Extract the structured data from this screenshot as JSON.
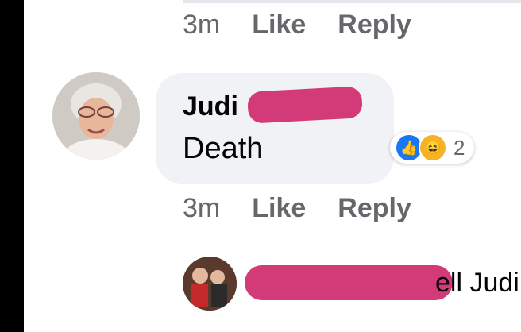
{
  "comment_above": {
    "time": "3m",
    "like_label": "Like",
    "reply_label": "Reply"
  },
  "comment": {
    "author": "Judi",
    "text": "Death",
    "time": "3m",
    "like_label": "Like",
    "reply_label": "Reply",
    "reactions": {
      "icons": [
        "like-reaction",
        "haha-reaction"
      ],
      "count": "2"
    }
  },
  "reply_preview": {
    "text": "ell Judi"
  },
  "colors": {
    "bubble": "#f0f2f5",
    "meta_text": "#65676b",
    "like_blue": "#1877f2",
    "haha_yellow": "#f7b125",
    "redaction": "#d33a78"
  }
}
